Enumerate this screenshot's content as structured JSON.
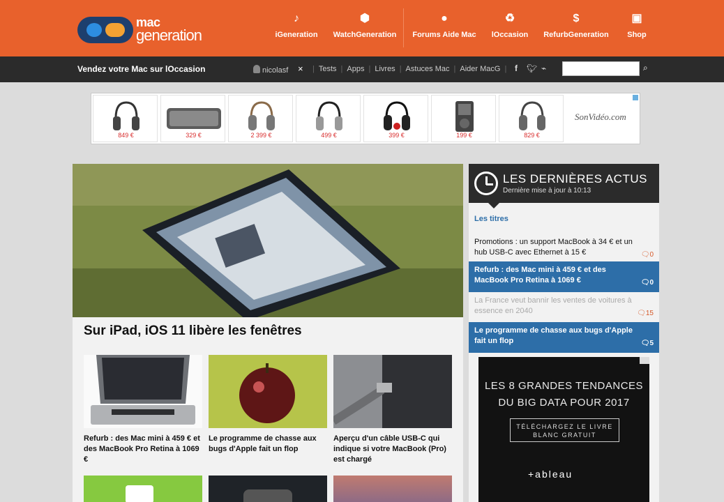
{
  "header": {
    "logo_top": "mac",
    "logo_bottom": "generation",
    "sites": [
      {
        "label": "iGeneration",
        "icon": "earphones-icon"
      },
      {
        "label": "WatchGeneration",
        "icon": "hexagon-grid-icon"
      },
      {
        "label": "Forums Aide Mac",
        "icon": "chat-bubble-icon"
      },
      {
        "label": "lOccasion",
        "icon": "recycle-icon"
      },
      {
        "label": "RefurbGeneration",
        "icon": "dollar-laptop-icon"
      },
      {
        "label": "Shop",
        "icon": "shop-bag-icon"
      }
    ],
    "brand_color": "#e8612c"
  },
  "navbar": {
    "sell_label": "Vendez votre Mac sur lOccasion",
    "username": "nicolasf",
    "close_glyph": "×",
    "links": [
      "Tests",
      "Apps",
      "Livres",
      "Astuces Mac",
      "Aider MacG"
    ],
    "social": [
      "f",
      "t",
      "rss"
    ],
    "search_placeholder": "",
    "search_glyph": "⌕"
  },
  "ad_strip": {
    "prices": [
      "849 €",
      "329 €",
      "2 399 €",
      "499 €",
      "399 €",
      "199 €",
      "829 €"
    ],
    "brand": "SonVidéo.com"
  },
  "hero": {
    "title": "Sur iPad, iOS 11 libère les fenêtres"
  },
  "cards": [
    {
      "title": "Refurb : des Mac mini à 459 € et des MacBook Pro Retina à 1069 €"
    },
    {
      "title": "Le programme de chasse aux bugs d'Apple fait un flop"
    },
    {
      "title": "Aperçu d'un câble USB-C qui indique si votre MacBook (Pro) est chargé"
    }
  ],
  "sidebar": {
    "title": "LES DERNIÈRES ACTUS",
    "subtitle": "Dernière mise à jour à 10:13",
    "tab": "Les titres",
    "news": [
      {
        "title": "Promotions : un support MacBook à 34 € et un hub USB-C avec Ethernet à 15 €",
        "comments": "0",
        "style": "plain"
      },
      {
        "title": "Refurb : des Mac mini à 459 € et des MacBook Pro Retina à 1069 €",
        "comments": "0",
        "style": "blue"
      },
      {
        "title": "La France veut bannir les ventes de voitures à essence en 2040",
        "comments": "15",
        "style": "faded"
      },
      {
        "title": "Le programme de chasse aux bugs d'Apple fait un flop",
        "comments": "5",
        "style": "blue"
      }
    ],
    "ad": {
      "line1": "LES 8 GRANDES TENDANCES",
      "line2": "DU BIG DATA POUR 2017",
      "button": "TÉLÉCHARGEZ LE LIVRE BLANC GRATUIT",
      "logo": "+ableau"
    }
  }
}
